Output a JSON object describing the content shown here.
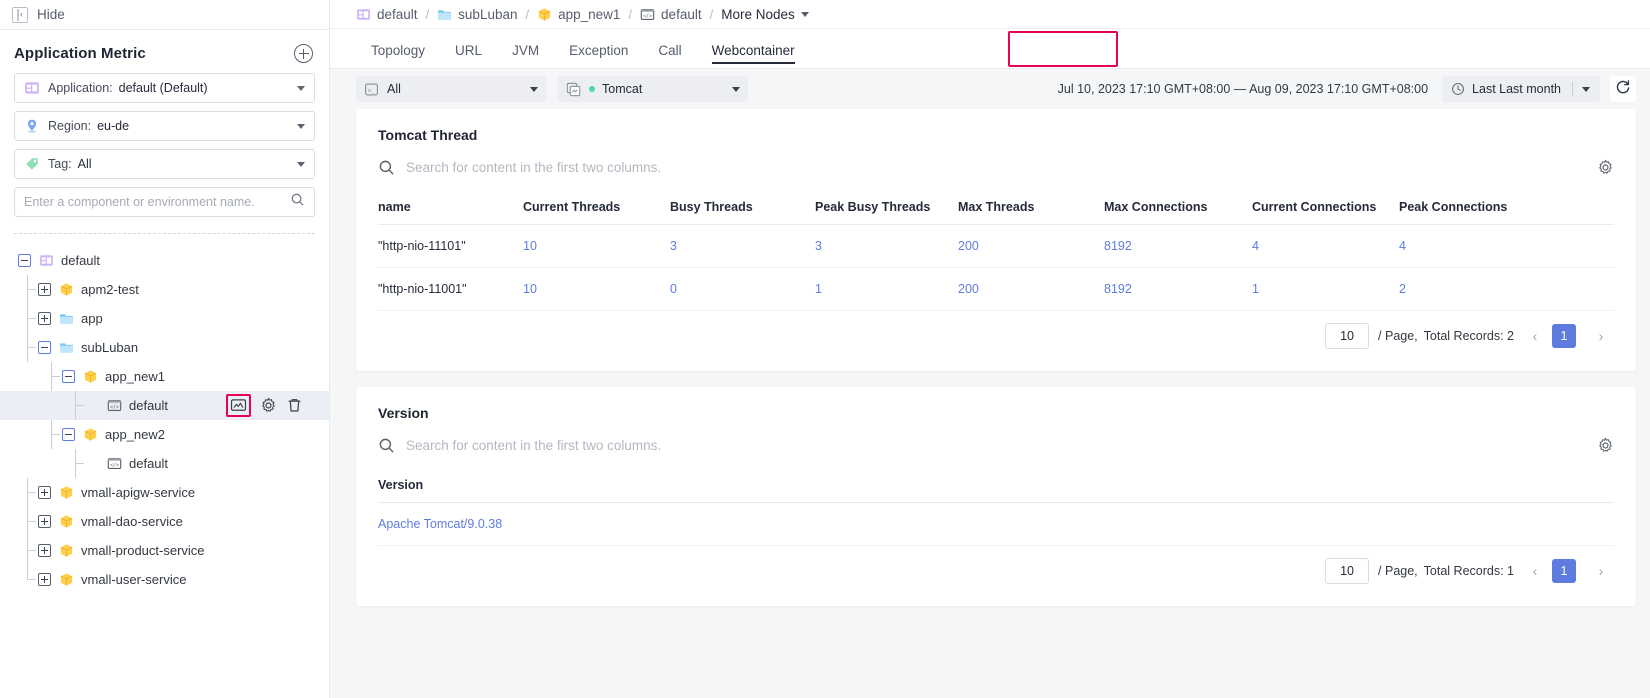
{
  "sidebar": {
    "hide_label": "Hide",
    "panel_title": "Application Metric",
    "add_icon": "plus-circle-icon",
    "filters": [
      {
        "icon": "application-icon",
        "label": "Application:",
        "value": "default (Default)"
      },
      {
        "icon": "region-pin-icon",
        "label": "Region:",
        "value": "eu-de"
      },
      {
        "icon": "tag-icon",
        "label": "Tag:",
        "value": "All"
      }
    ],
    "search_placeholder": "Enter a component or environment name.",
    "search_value": "",
    "search_icon": "search-icon",
    "tree": [
      {
        "label": "default",
        "icon": "application-icon",
        "toggle": "minus",
        "depth": 0
      },
      {
        "label": "apm2-test",
        "icon": "component-icon",
        "toggle": "plus",
        "depth": 1
      },
      {
        "label": "app",
        "icon": "folder-icon",
        "toggle": "plus",
        "depth": 1
      },
      {
        "label": "subLuban",
        "icon": "folder-icon",
        "toggle": "minus",
        "depth": 1
      },
      {
        "label": "app_new1",
        "icon": "component-icon",
        "toggle": "minus",
        "depth": 2
      },
      {
        "label": "default",
        "icon": "env-icon",
        "toggle": "none",
        "depth": 3,
        "selected": true,
        "actions": [
          "monitor-icon",
          "gear-icon",
          "trash-icon"
        ],
        "highlight_action": "monitor-icon"
      },
      {
        "label": "app_new2",
        "icon": "component-icon",
        "toggle": "minus",
        "depth": 2
      },
      {
        "label": "default",
        "icon": "env-icon",
        "toggle": "none",
        "depth": 3
      },
      {
        "label": "vmall-apigw-service",
        "icon": "component-icon",
        "toggle": "plus",
        "depth": 1
      },
      {
        "label": "vmall-dao-service",
        "icon": "component-icon",
        "toggle": "plus",
        "depth": 1
      },
      {
        "label": "vmall-product-service",
        "icon": "component-icon",
        "toggle": "plus",
        "depth": 1
      },
      {
        "label": "vmall-user-service",
        "icon": "component-icon",
        "toggle": "plus",
        "depth": 1
      }
    ]
  },
  "breadcrumb": [
    {
      "label": "default",
      "icon": "application-icon"
    },
    {
      "label": "subLuban",
      "icon": "folder-icon"
    },
    {
      "label": "app_new1",
      "icon": "component-icon"
    },
    {
      "label": "default",
      "icon": "env-icon"
    },
    {
      "label": "More Nodes",
      "icon": "none",
      "dropdown": true
    }
  ],
  "tabs": [
    {
      "label": "Topology",
      "active": false
    },
    {
      "label": "URL",
      "active": false
    },
    {
      "label": "JVM",
      "active": false
    },
    {
      "label": "Exception",
      "active": false
    },
    {
      "label": "Call",
      "active": false
    },
    {
      "label": "Webcontainer",
      "active": true
    }
  ],
  "filters": {
    "instance": {
      "icon": "terminal-icon",
      "value": "All"
    },
    "container": {
      "icon": "stack-icon",
      "value": "Tomcat",
      "status_color": "#4bd9a5"
    },
    "time_range": "Jul 10, 2023 17:10 GMT+08:00 — Aug 09, 2023 17:10 GMT+08:00",
    "time_preset": "Last Last month",
    "clock_icon": "clock-icon",
    "refresh_icon": "refresh-icon"
  },
  "thread_card": {
    "title": "Tomcat Thread",
    "search_placeholder": "Search for content in the first two columns.",
    "search_value": "",
    "settings_icon": "gear-icon",
    "columns": [
      "name",
      "Current Threads",
      "Busy Threads",
      "Peak Busy Threads",
      "Max Threads",
      "Max Connections",
      "Current Connections",
      "Peak Connections"
    ],
    "rows": [
      [
        "\"http-nio-11101\"",
        "10",
        "3",
        "3",
        "200",
        "8192",
        "4",
        "4"
      ],
      [
        "\"http-nio-11001\"",
        "10",
        "0",
        "1",
        "200",
        "8192",
        "1",
        "2"
      ]
    ],
    "pager": {
      "page_size": "10",
      "per_page_label": "/ Page,",
      "total_label": "Total Records: 2",
      "prev": "‹",
      "current_page": "1",
      "next": "›"
    }
  },
  "version_card": {
    "title": "Version",
    "search_placeholder": "Search for content in the first two columns.",
    "search_value": "",
    "settings_icon": "gear-icon",
    "columns": [
      "Version"
    ],
    "rows": [
      [
        "Apache Tomcat/9.0.38"
      ]
    ],
    "pager": {
      "page_size": "10",
      "per_page_label": "/ Page,",
      "total_label": "Total Records: 1",
      "prev": "‹",
      "current_page": "1",
      "next": "›"
    }
  },
  "colors": {
    "accent": "#5e7ce0",
    "highlight": "#e8005a",
    "green": "#4bd9a5"
  }
}
